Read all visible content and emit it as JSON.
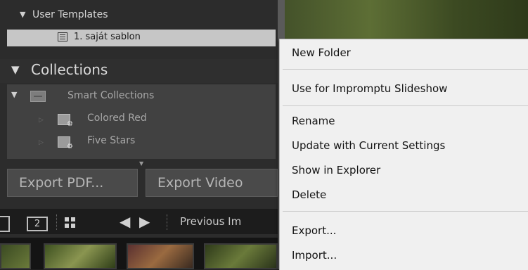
{
  "left_panel": {
    "user_templates_label": "User Templates",
    "template_item": "1. saját sablon",
    "collections_label": "Collections",
    "smart_collections_label": "Smart Collections",
    "collection_items": [
      "Colored Red",
      "Five Stars"
    ]
  },
  "buttons": {
    "export_pdf": "Export PDF...",
    "export_video": "Export Video"
  },
  "toolbar": {
    "page_number": "2",
    "previous_label": "Previous Im"
  },
  "context_menu": {
    "items": [
      "New Folder",
      "Use for Impromptu Slideshow",
      "Rename",
      "Update with Current Settings",
      "Show in Explorer",
      "Delete",
      "Export...",
      "Import..."
    ]
  }
}
